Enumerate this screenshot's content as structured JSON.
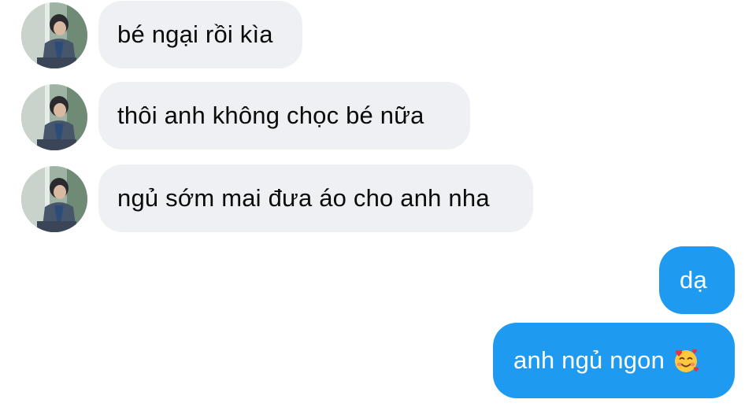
{
  "conversation": {
    "incoming": [
      {
        "text": "bé ngại rồi kìa"
      },
      {
        "text": "thôi anh không chọc bé nữa"
      },
      {
        "text": "ngủ sớm mai đưa áo cho anh nha"
      }
    ],
    "outgoing": [
      {
        "text": "dạ"
      },
      {
        "text": "anh ngủ ngon",
        "emoji": "smiling-face-with-hearts-icon"
      }
    ]
  },
  "colors": {
    "incoming_bubble": "#eef0f4",
    "outgoing_bubble": "#1f9af1",
    "outgoing_text": "#ffffff"
  }
}
